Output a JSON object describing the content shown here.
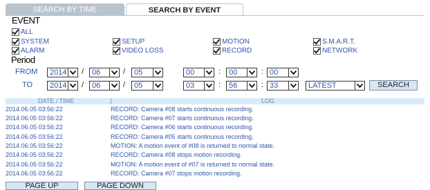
{
  "tabs": {
    "time": "SEARCH BY TIME",
    "event": "SEARCH BY EVENT"
  },
  "event": {
    "title": "EVENT",
    "all": "ALL",
    "items": {
      "system": "SYSTEM",
      "setup": "SETUP",
      "motion": "MOTION",
      "smart": "S.M.A.R.T.",
      "alarm": "ALARM",
      "video_loss": "VIDEO LOSS",
      "record": "RECORD",
      "network": "NETWORK"
    }
  },
  "period": {
    "title": "Period",
    "from_label": "FROM",
    "to_label": "TO",
    "from": {
      "year": "2014",
      "month": "06",
      "day": "05",
      "hour": "00",
      "min": "00",
      "sec": "00"
    },
    "to": {
      "year": "2014",
      "month": "06",
      "day": "05",
      "hour": "03",
      "min": "56",
      "sec": "33"
    },
    "order": "LATEST",
    "search_label": "SEARCH"
  },
  "log": {
    "col_date": "DATE / TIME",
    "col_log": "LOG",
    "rows": [
      {
        "date": "2014.06.05  03:56:22",
        "msg": "RECORD: Camera #08 starts continuous recording."
      },
      {
        "date": "2014.06.05  03:56:22",
        "msg": "RECORD: Camera #07 starts continuous recording."
      },
      {
        "date": "2014.06.05  03:56:22",
        "msg": "RECORD: Camera #06 starts continuous recording."
      },
      {
        "date": "2014.06.05  03:56:22",
        "msg": "RECORD: Camera #05 starts continuous recording."
      },
      {
        "date": "2014.06.05  03:56:22",
        "msg": "MOTION: A motion event of #08 is returned to normal state."
      },
      {
        "date": "2014.06.05  03:56:22",
        "msg": "RECORD: Camera #08 stops motion recording."
      },
      {
        "date": "2014.06.05  03:56:22",
        "msg": "MOTION: A motion event of #07 is returned to normal state."
      },
      {
        "date": "2014.06.05  03:56:22",
        "msg": "RECORD: Camera #07 stops motion recording."
      }
    ]
  },
  "pager": {
    "up": "PAGE UP",
    "down": "PAGE DOWN"
  }
}
